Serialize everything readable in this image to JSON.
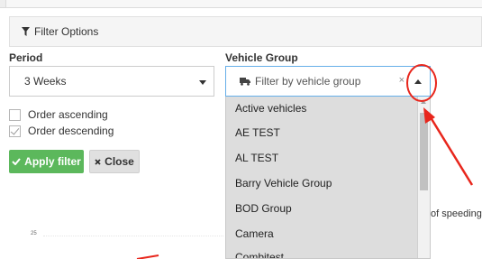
{
  "filter_panel": {
    "title": "Filter Options",
    "period": {
      "label": "Period",
      "selected": "3 Weeks"
    },
    "order": {
      "ascending_label": "Order ascending",
      "ascending_checked": false,
      "descending_label": "Order descending",
      "descending_checked": true
    },
    "buttons": {
      "apply": "Apply filter",
      "close": "Close"
    },
    "vehicle_group": {
      "label": "Vehicle Group",
      "placeholder": "Filter by vehicle group",
      "clear_glyph": "×",
      "options": [
        "Active vehicles",
        "AE TEST",
        "AL TEST",
        "Barry Vehicle Group",
        "BOD Group",
        "Camera",
        "Combitest"
      ]
    }
  },
  "background": {
    "partial_text": "of speeding",
    "axis_tick": "25"
  },
  "colors": {
    "apply": "#5cb85c",
    "focus_border": "#66afe9",
    "annotation": "#e8261c"
  }
}
